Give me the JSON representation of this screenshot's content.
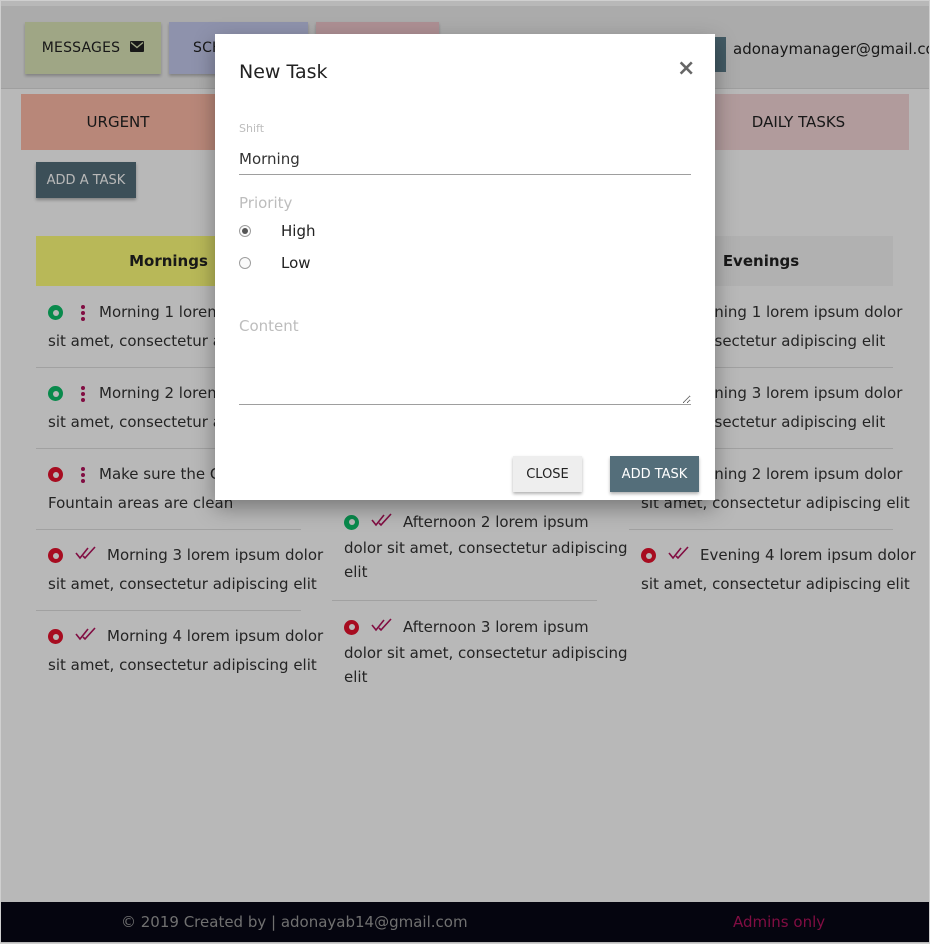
{
  "nav": {
    "messages_label": "MESSAGES",
    "schedule_label": "SCH",
    "user_email": "adonaymanager@gmail.com"
  },
  "categories": {
    "urgent": "URGENT",
    "daily": "DAILY TASKS"
  },
  "add_task_label": "ADD A TASK",
  "columns": {
    "morning": {
      "title": "Mornings",
      "tasks": [
        {
          "status": "done",
          "line1": "Morning 1 lorem i",
          "line2": "sit amet, consectetur adipi"
        },
        {
          "status": "done",
          "line1": "Morning 2 lorem i",
          "line2": "sit amet, consectetur adipi"
        },
        {
          "status": "pending",
          "line1": "Make sure the Co",
          "line2": "Fountain areas are clean"
        },
        {
          "status": "pending",
          "line1": "Morning 3 lorem ipsum dolor",
          "line2": "sit amet, consectetur adipiscing elit"
        },
        {
          "status": "pending",
          "line1": "Morning 4 lorem ipsum dolor",
          "line2": "sit amet, consectetur adipiscing elit"
        }
      ]
    },
    "afternoon": {
      "tasks": [
        {
          "status": "done",
          "line1": "Afternoon 2 lorem ipsum",
          "line2": "dolor sit amet, consectetur adipiscing",
          "line3": "elit"
        },
        {
          "status": "pending",
          "line1": "Afternoon 3 lorem ipsum",
          "line2": "dolor sit amet, consectetur adipiscing",
          "line3": "elit"
        }
      ]
    },
    "evening": {
      "title": "Evenings",
      "tasks": [
        {
          "line1": "ening 1 lorem ipsum dolor",
          "line2": "nsectetur adipiscing elit"
        },
        {
          "line1": "ening 3 lorem ipsum dolor",
          "line2": "nsectetur adipiscing elit"
        },
        {
          "line1": "ening 2 lorem ipsum dolor",
          "line2": "sit amet, consectetur adipiscing elit"
        },
        {
          "status": "pending",
          "line1": "Evening 4 lorem ipsum dolor",
          "line2": "sit amet, consectetur adipiscing elit"
        }
      ]
    }
  },
  "modal": {
    "title": "New Task",
    "close_glyph": "×",
    "shift_label": "Shift",
    "shift_value": "Morning",
    "priority_label": "Priority",
    "priority_options": [
      {
        "label": "High",
        "checked": true
      },
      {
        "label": "Low",
        "checked": false
      }
    ],
    "content_label": "Content",
    "content_value": "",
    "close_button": "CLOSE",
    "add_button": "ADD TASK"
  },
  "footer": {
    "credit": "© 2019 Created by | adonayab14@gmail.com",
    "admins": "Admins only"
  },
  "colors": {
    "done": "#0dbf6a",
    "pending": "#e8112d",
    "accent": "#b3125c",
    "primary_button": "#546e7a"
  },
  "icons": {
    "messages": "envelope-icon",
    "task_menu": "kebab-menu-icon",
    "task_done": "double-check-icon",
    "modal_close": "close-icon"
  }
}
